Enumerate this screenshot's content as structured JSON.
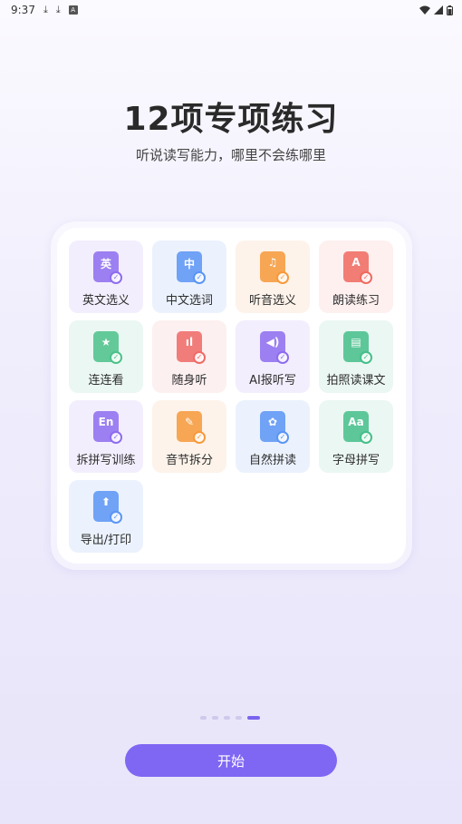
{
  "status": {
    "time": "9:37"
  },
  "title": "12项专项练习",
  "subtitle": "听说读写能力，哪里不会练哪里",
  "tiles": [
    {
      "label": "英文选义",
      "glyph": "英",
      "icon": "english-meaning-icon",
      "color": "#8e6cf0",
      "bg": "purple"
    },
    {
      "label": "中文选词",
      "glyph": "中",
      "icon": "chinese-word-icon",
      "color": "#5b95f5",
      "bg": "blue"
    },
    {
      "label": "听音选义",
      "glyph": "♫",
      "icon": "headphone-icon",
      "color": "#f7993a",
      "bg": "orange"
    },
    {
      "label": "朗读练习",
      "glyph": "A",
      "icon": "read-aloud-icon",
      "color": "#f06a60",
      "bg": "red"
    },
    {
      "label": "连连看",
      "glyph": "★",
      "icon": "match-icon",
      "color": "#4cc28a",
      "bg": "green"
    },
    {
      "label": "随身听",
      "glyph": "ıl",
      "icon": "portable-listen-icon",
      "color": "#f06a66",
      "bg": "pink"
    },
    {
      "label": "AI报听写",
      "glyph": "◀)",
      "icon": "ai-dictation-icon",
      "color": "#8e6cf0",
      "bg": "purple"
    },
    {
      "label": "拍照读课文",
      "glyph": "▤",
      "icon": "photo-read-icon",
      "color": "#45bf8a",
      "bg": "green"
    },
    {
      "label": "拆拼写训练",
      "glyph": "En",
      "icon": "spelling-split-icon",
      "color": "#8e6cf0",
      "bg": "purple"
    },
    {
      "label": "音节拆分",
      "glyph": "✎",
      "icon": "syllable-split-icon",
      "color": "#f7993a",
      "bg": "orange"
    },
    {
      "label": "自然拼读",
      "glyph": "✿",
      "icon": "phonics-icon",
      "color": "#5b95f5",
      "bg": "blue"
    },
    {
      "label": "字母拼写",
      "glyph": "Aa",
      "icon": "letter-spelling-icon",
      "color": "#45bf8a",
      "bg": "green"
    },
    {
      "label": "导出/打印",
      "glyph": "⬆",
      "icon": "export-print-icon",
      "color": "#5b95f5",
      "bg": "blue"
    }
  ],
  "pager": {
    "count": 5,
    "active": 4
  },
  "start_button": "开始"
}
